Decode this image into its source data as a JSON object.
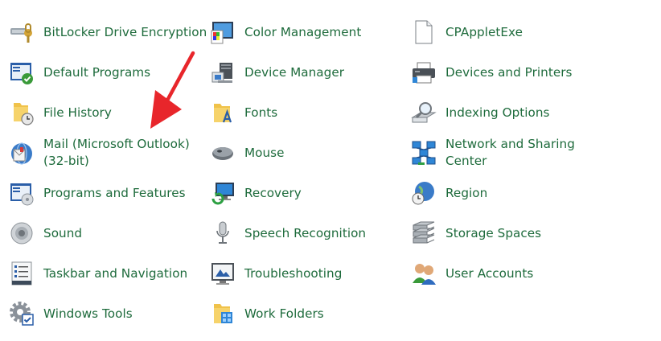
{
  "items": {
    "bitlocker": {
      "label": "BitLocker Drive Encryption",
      "icon": "bitlocker-icon"
    },
    "color_management": {
      "label": "Color Management",
      "icon": "color-management-icon"
    },
    "cpappletexe": {
      "label": "CPAppletExe",
      "icon": "blank-document-icon"
    },
    "default_programs": {
      "label": "Default Programs",
      "icon": "default-programs-icon"
    },
    "device_manager": {
      "label": "Device Manager",
      "icon": "device-manager-icon"
    },
    "devices_printers": {
      "label": "Devices and Printers",
      "icon": "printer-icon"
    },
    "file_history": {
      "label": "File History",
      "icon": "file-history-icon"
    },
    "fonts": {
      "label": "Fonts",
      "icon": "fonts-folder-icon"
    },
    "indexing_options": {
      "label": "Indexing Options",
      "icon": "indexing-search-icon"
    },
    "mail": {
      "label": "Mail (Microsoft Outlook)\n(32-bit)",
      "icon": "mail-icon"
    },
    "mouse": {
      "label": "Mouse",
      "icon": "mouse-icon"
    },
    "network_sharing": {
      "label": "Network and Sharing\nCenter",
      "icon": "network-icon"
    },
    "programs_features": {
      "label": "Programs and Features",
      "icon": "programs-features-icon"
    },
    "recovery": {
      "label": "Recovery",
      "icon": "recovery-icon"
    },
    "region": {
      "label": "Region",
      "icon": "globe-clock-icon"
    },
    "sound": {
      "label": "Sound",
      "icon": "speaker-icon"
    },
    "speech_recognition": {
      "label": "Speech Recognition",
      "icon": "microphone-icon"
    },
    "storage_spaces": {
      "label": "Storage Spaces",
      "icon": "storage-drives-icon"
    },
    "taskbar_navigation": {
      "label": "Taskbar and Navigation",
      "icon": "taskbar-icon"
    },
    "troubleshooting": {
      "label": "Troubleshooting",
      "icon": "troubleshooting-icon"
    },
    "user_accounts": {
      "label": "User Accounts",
      "icon": "users-icon"
    },
    "windows_tools": {
      "label": "Windows Tools",
      "icon": "gear-checkbox-icon"
    },
    "work_folders": {
      "label": "Work Folders",
      "icon": "work-folders-icon"
    }
  },
  "colors": {
    "link": "#1e6b3c",
    "arrow": "#e8262b",
    "folder": "#f0c24a"
  }
}
